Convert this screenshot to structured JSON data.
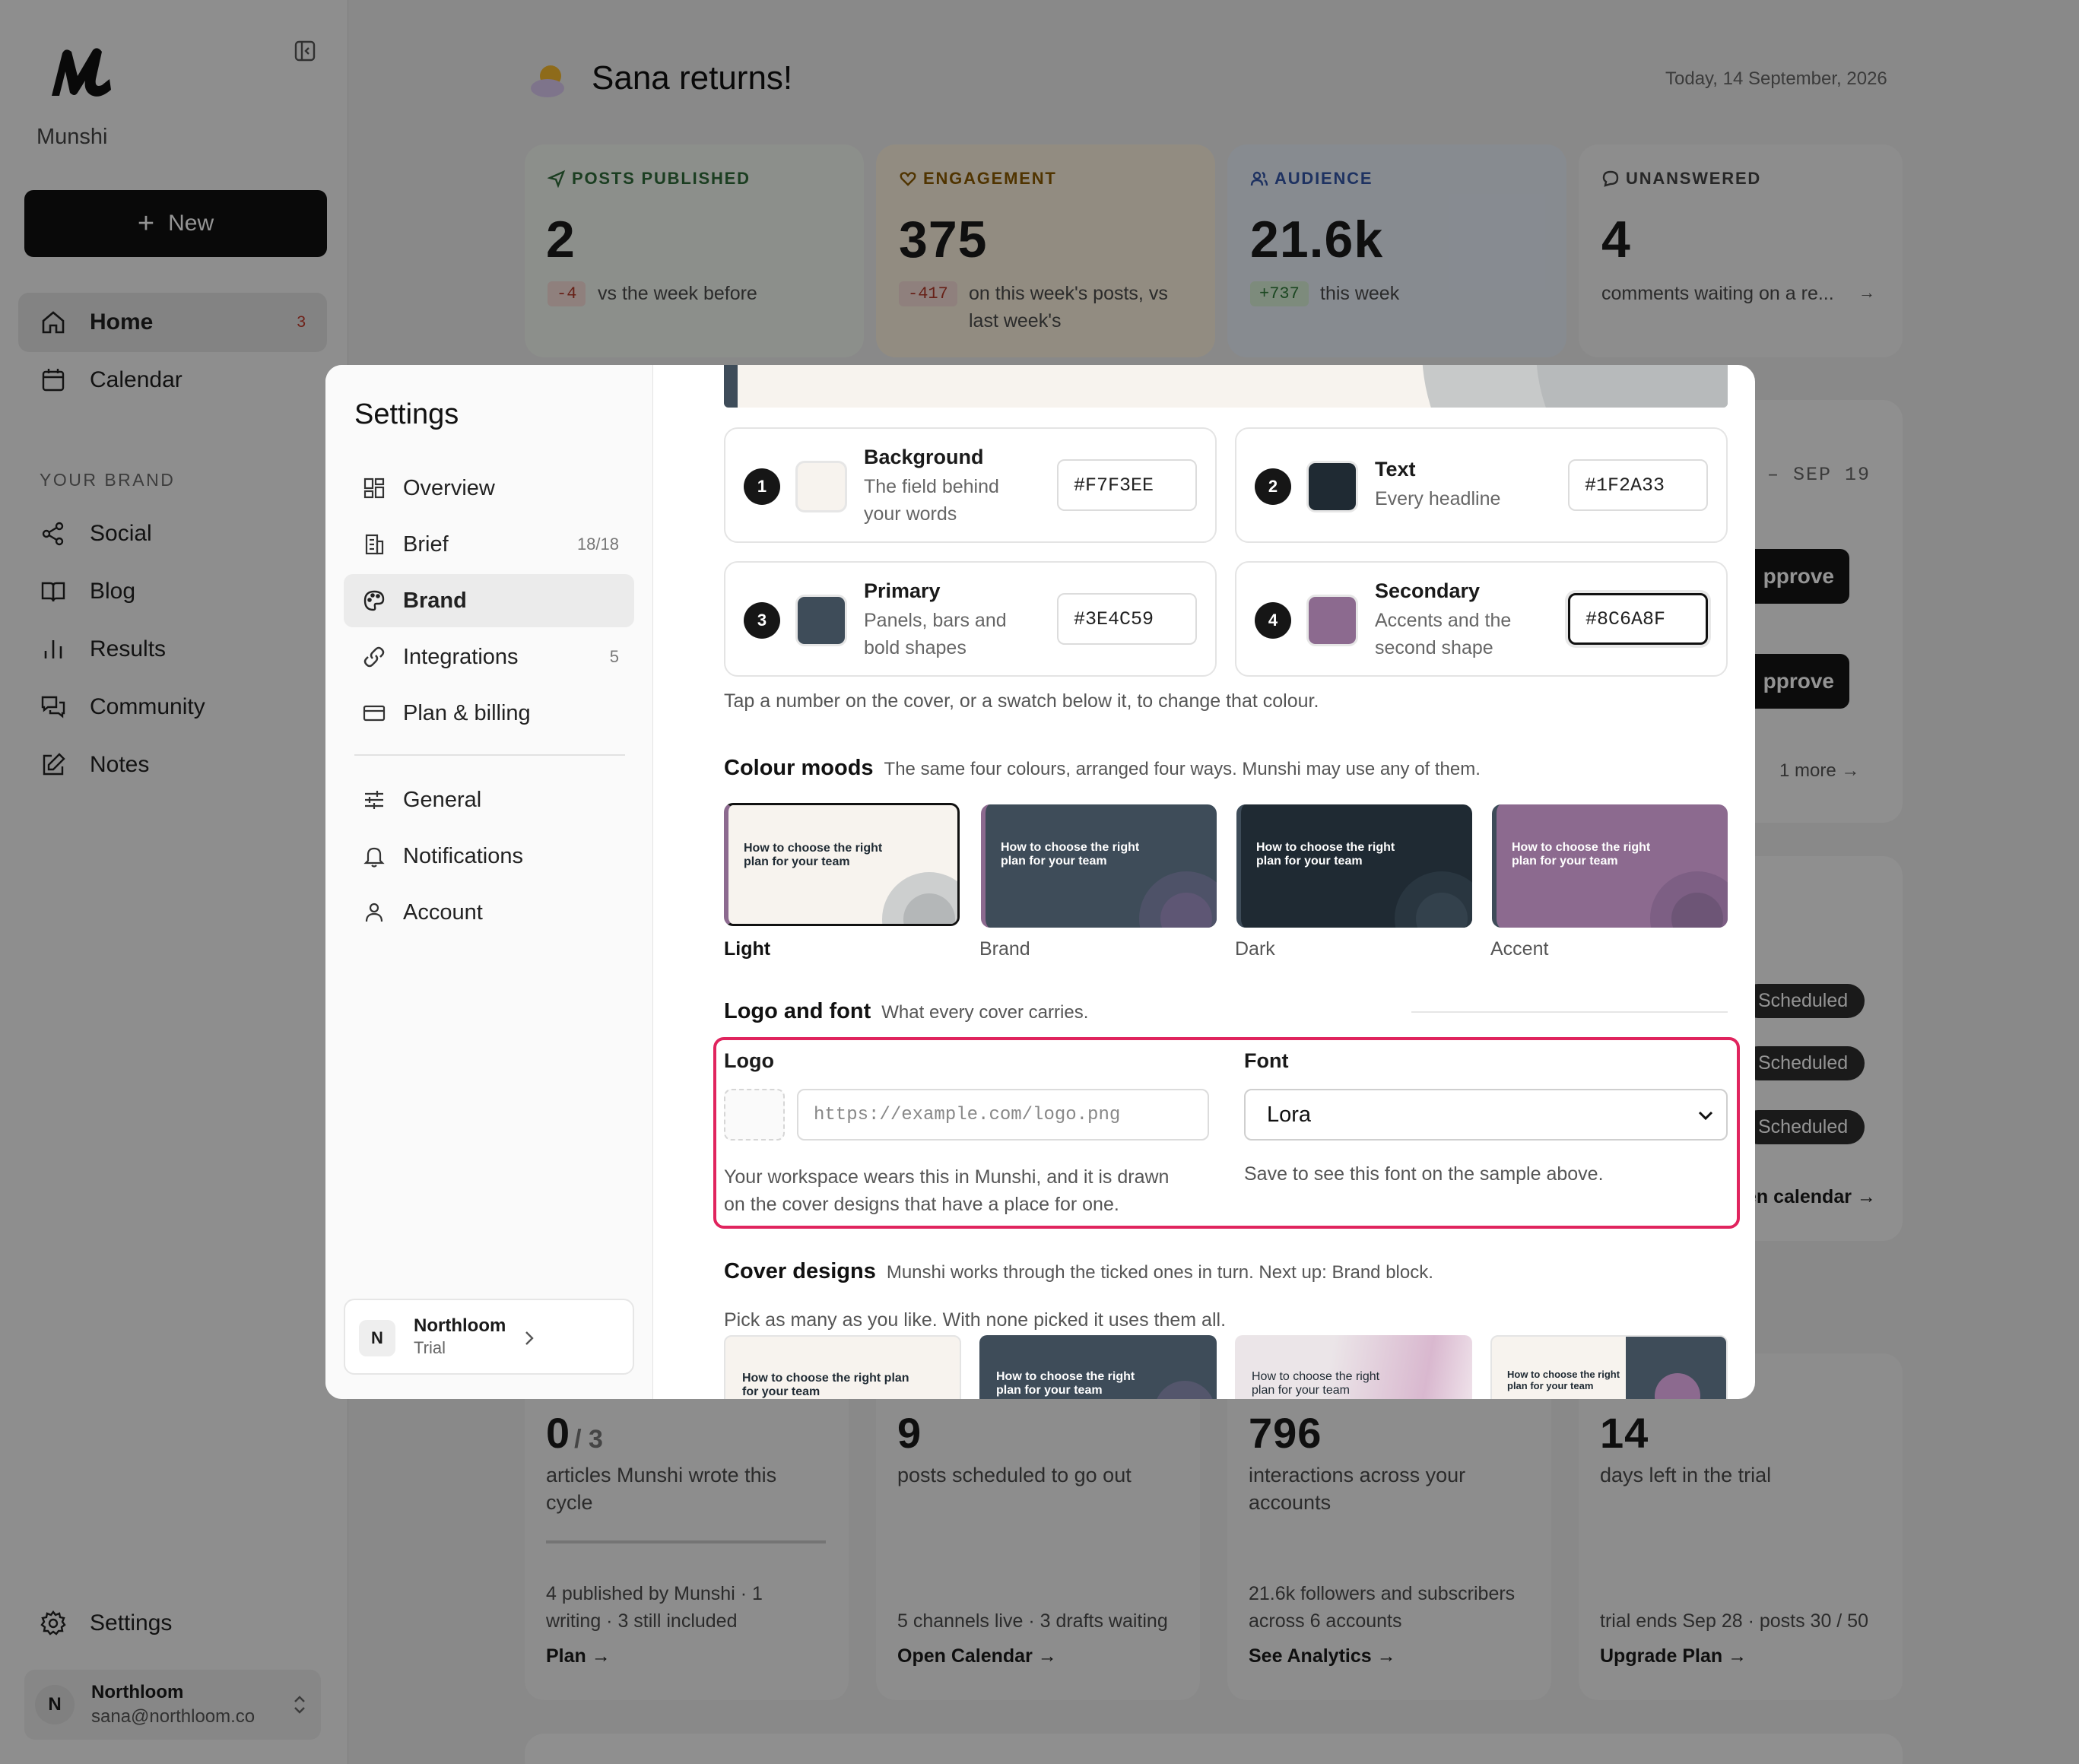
{
  "sidebar": {
    "brand_name": "Munshi",
    "new_button": "New",
    "nav": [
      {
        "label": "Home",
        "badge": "3",
        "icon": "home-icon"
      },
      {
        "label": "Calendar",
        "icon": "calendar-icon"
      }
    ],
    "section_title": "YOUR BRAND",
    "brand_nav": [
      {
        "label": "Social",
        "icon": "share-icon"
      },
      {
        "label": "Blog",
        "icon": "book-icon"
      },
      {
        "label": "Results",
        "icon": "bar-chart-icon"
      },
      {
        "label": "Community",
        "icon": "chat-icon"
      },
      {
        "label": "Notes",
        "icon": "edit-icon"
      }
    ],
    "settings_label": "Settings",
    "user": {
      "initial": "N",
      "name": "Northloom",
      "email": "sana@northloom.co"
    }
  },
  "header": {
    "greeting": "Sana returns!",
    "date": "Today, 14 September, 2026"
  },
  "stats": [
    {
      "label": "POSTS PUBLISHED",
      "value": "2",
      "delta": "-4",
      "caption": "vs the week before",
      "color": "#2f6b3a",
      "icon": "send-icon"
    },
    {
      "label": "ENGAGEMENT",
      "value": "375",
      "delta": "-417",
      "caption": "on this week's posts, vs last week's",
      "color": "#8a5a00",
      "icon": "heart-icon"
    },
    {
      "label": "AUDIENCE",
      "value": "21.6k",
      "delta": "+737",
      "caption": "this week",
      "color": "#3456a8",
      "icon": "users-icon"
    },
    {
      "label": "UNANSWERED",
      "value": "4",
      "caption": "comments waiting on a re...",
      "color": "#444444",
      "icon": "comment-icon"
    }
  ],
  "background_panel": {
    "range": "– SEP 19",
    "approve": "pprove",
    "more": "1 more",
    "scheduled": "Scheduled",
    "calendar_link": "en calendar →"
  },
  "bottom_stats": [
    {
      "value": "0",
      "suffix": "/ 3",
      "caption": "articles Munshi wrote this cycle",
      "detail": "4 published by Munshi · 1 writing · 3 still included",
      "link": "Plan →"
    },
    {
      "value": "9",
      "caption": "posts scheduled to go out",
      "detail": "5 channels live · 3 drafts waiting",
      "link": "Open Calendar →"
    },
    {
      "value": "796",
      "caption": "interactions across your accounts",
      "detail": "21.6k followers and subscribers across 6 accounts",
      "link": "See Analytics →"
    },
    {
      "value": "14",
      "caption": "days left in the trial",
      "detail": "trial ends Sep 28 · posts 30 / 50",
      "link": "Upgrade Plan →"
    }
  ],
  "modal": {
    "title": "Settings",
    "nav": [
      {
        "label": "Overview",
        "icon": "grid-icon"
      },
      {
        "label": "Brief",
        "count": "18/18",
        "icon": "building-icon"
      },
      {
        "label": "Brand",
        "icon": "palette-icon",
        "active": true
      },
      {
        "label": "Integrations",
        "count": "5",
        "icon": "link-icon"
      },
      {
        "label": "Plan & billing",
        "icon": "credit-card-icon"
      },
      {
        "label": "General",
        "icon": "sliders-icon"
      },
      {
        "label": "Notifications",
        "icon": "bell-icon"
      },
      {
        "label": "Account",
        "icon": "user-icon"
      }
    ],
    "workspace": {
      "initial": "N",
      "name": "Northloom",
      "plan": "Trial"
    },
    "colors": [
      {
        "num": "1",
        "title": "Background",
        "desc": "The field behind your words",
        "hex": "#F7F3EE"
      },
      {
        "num": "2",
        "title": "Text",
        "desc": "Every headline",
        "hex": "#1F2A33"
      },
      {
        "num": "3",
        "title": "Primary",
        "desc": "Panels, bars and bold shapes",
        "hex": "#3E4C59"
      },
      {
        "num": "4",
        "title": "Secondary",
        "desc": "Accents and the second shape",
        "hex": "#8C6A8F"
      }
    ],
    "colors_hint": "Tap a number on the cover, or a swatch below it, to change that colour.",
    "moods_title": "Colour moods",
    "moods_desc": "The same four colours, arranged four ways. Munshi may use any of them.",
    "mood_sample_text": "How to choose the right plan for your team",
    "moods": [
      {
        "label": "Light",
        "selected": true
      },
      {
        "label": "Brand"
      },
      {
        "label": "Dark"
      },
      {
        "label": "Accent"
      }
    ],
    "logo_font_title": "Logo and font",
    "logo_font_desc": "What every cover carries.",
    "logo_label": "Logo",
    "logo_placeholder": "https://example.com/logo.png",
    "logo_help": "Your workspace wears this in Munshi, and it is drawn on the cover designs that have a place for one.",
    "font_label": "Font",
    "font_value": "Lora",
    "font_help": "Save to see this font on the sample above.",
    "covers_title": "Cover designs",
    "covers_desc": "Munshi works through the ticked ones in turn. Next up: Brand block.",
    "covers_hint": "Pick as many as you like. With none picked it uses them all.",
    "cover_texts": [
      "How to choose the right plan for your team",
      "How to choose the right plan for your team",
      "How to choose the right plan for your team",
      "How to choose the right plan for your team"
    ],
    "highlight_color": "#e0245e"
  }
}
